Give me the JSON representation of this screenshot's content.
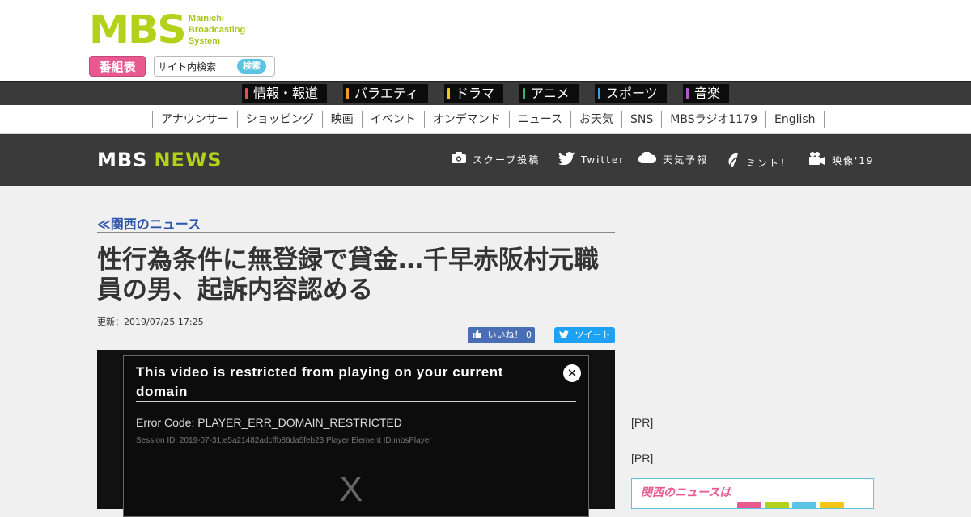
{
  "header": {
    "logo_mark": "MBS",
    "logo_sub": [
      "Mainichi",
      "Broadcasting",
      "System"
    ],
    "schedule_label": "番組表",
    "search_value": "サイト内検索",
    "search_button": "検索"
  },
  "genres": [
    {
      "label": "情報・報道",
      "color": "#e0534a"
    },
    {
      "label": "バラエティ",
      "color": "#f0a020"
    },
    {
      "label": "ドラマ",
      "color": "#f5c518"
    },
    {
      "label": "アニメ",
      "color": "#3bb273"
    },
    {
      "label": "スポーツ",
      "color": "#3aa0d8"
    },
    {
      "label": "音楽",
      "color": "#b05cc8"
    }
  ],
  "subnav": [
    "アナウンサー",
    "ショッピング",
    "映画",
    "イベント",
    "オンデマンド",
    "ニュース",
    "お天気",
    "SNS",
    "MBSラジオ1179",
    "English"
  ],
  "news_header": {
    "logo_left": "MBS",
    "logo_right": "NEWS",
    "links": [
      {
        "label": "スクープ投稿",
        "icon": "camera-icon"
      },
      {
        "label": "Twitter",
        "icon": "twitter-bird-icon"
      },
      {
        "label": "天気予報",
        "icon": "cloud-icon"
      },
      {
        "label": "ミント！",
        "icon": "leaf-icon"
      },
      {
        "label": "映像'19",
        "icon": "video-camera-icon"
      }
    ]
  },
  "article": {
    "breadcrumb": "≪関西のニュース",
    "title": "性行為条件に無登録で貸金…千早赤阪村元職員の男、起訴内容認める",
    "updated": "更新：2019/07/25 17:25",
    "like_label": "いいね！ 0",
    "tweet_label": "ツイート"
  },
  "player": {
    "error_title": "This video is restricted from playing on your current domain",
    "error_code": "Error Code: PLAYER_ERR_DOMAIN_RESTRICTED",
    "session": "Session ID: 2019-07-31:e5a21482adcffb86da5feb23 Player Element ID:mbsPlayer",
    "close": "✕",
    "placeholder_x": "X"
  },
  "sidebar": {
    "pr1": "[PR]",
    "pr2": "[PR]",
    "banner_text": "関西のニュースは"
  },
  "colors": {
    "brand_green": "#b3d11a",
    "dark_bar": "#3a3a3a",
    "link_blue": "#2a55a8",
    "pink": "#e85a8f"
  }
}
